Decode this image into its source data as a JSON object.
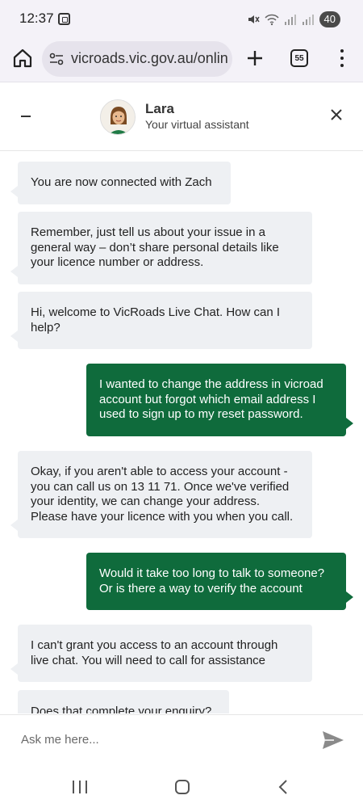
{
  "status_bar": {
    "time": "12:37",
    "battery": "40"
  },
  "browser": {
    "url": "vicroads.vic.gov.au/onlin",
    "tab_count": "55"
  },
  "chat_header": {
    "agent_name": "Lara",
    "agent_role": "Your virtual assistant"
  },
  "messages": [
    {
      "side": "in",
      "text": "You are now connected with Zach"
    },
    {
      "side": "in",
      "text": "Remember, just tell us about your issue in a general way – don’t share personal details like your licence number or address."
    },
    {
      "side": "in",
      "text": "Hi, welcome to VicRoads Live Chat. How can I help?"
    },
    {
      "side": "out",
      "text": "I wanted to change the address in vicroad account but forgot which email address I used to sign up to my reset password."
    },
    {
      "side": "in",
      "text": "Okay, if you aren't able to access your account - you can call us on 13 11 71. Once we've verified your identity, we can change your address. Please have your licence with you when you call."
    },
    {
      "side": "out",
      "text": "Would it take too long to talk to someone? Or is there a way to verify the account"
    },
    {
      "side": "in",
      "text": "I can't grant you access to an account through live chat. You will need to call for assistance"
    },
    {
      "side": "in",
      "text": "Does that complete your enquiry?"
    }
  ],
  "input": {
    "placeholder": "Ask me here..."
  },
  "colors": {
    "outgoing_bubble": "#0f6b3c",
    "incoming_bubble": "#eef0f3"
  }
}
